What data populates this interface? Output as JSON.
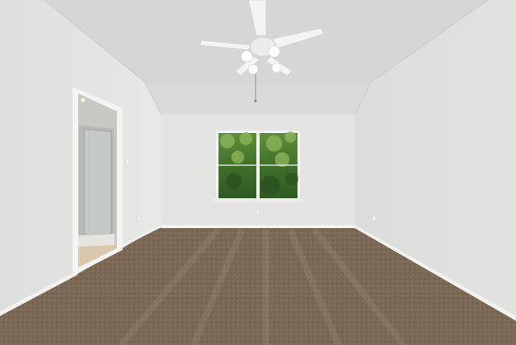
{
  "scene": {
    "description_kind": "empty-room-photo",
    "objects": [
      "ceiling-fan",
      "window",
      "doorway",
      "carpet",
      "baseboard",
      "outlet"
    ],
    "colors": {
      "wall": "#e4e4e2",
      "wall_shadow": "#d2d2d0",
      "ceiling": "#d9d9d7",
      "carpet": "#7d6a58",
      "carpet_light": "#8f7c69",
      "trim": "#f3f3f1",
      "foliage": "#3f6f2a",
      "foliage_light": "#7aa34d"
    }
  }
}
